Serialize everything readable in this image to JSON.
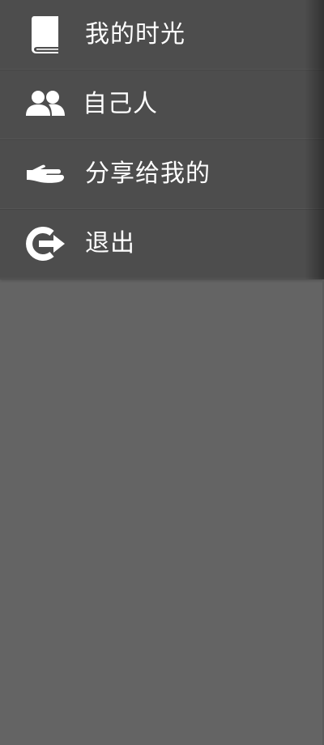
{
  "menu": {
    "items": [
      {
        "label": "我的时光",
        "icon": "book-icon"
      },
      {
        "label": "自己人",
        "icon": "people-icon"
      },
      {
        "label": "分享给我的",
        "icon": "hand-share-icon"
      },
      {
        "label": "退出",
        "icon": "logout-icon"
      }
    ]
  },
  "colors": {
    "menu_bg": "#4d4d4d",
    "page_bg": "#646464",
    "text": "#ffffff"
  }
}
